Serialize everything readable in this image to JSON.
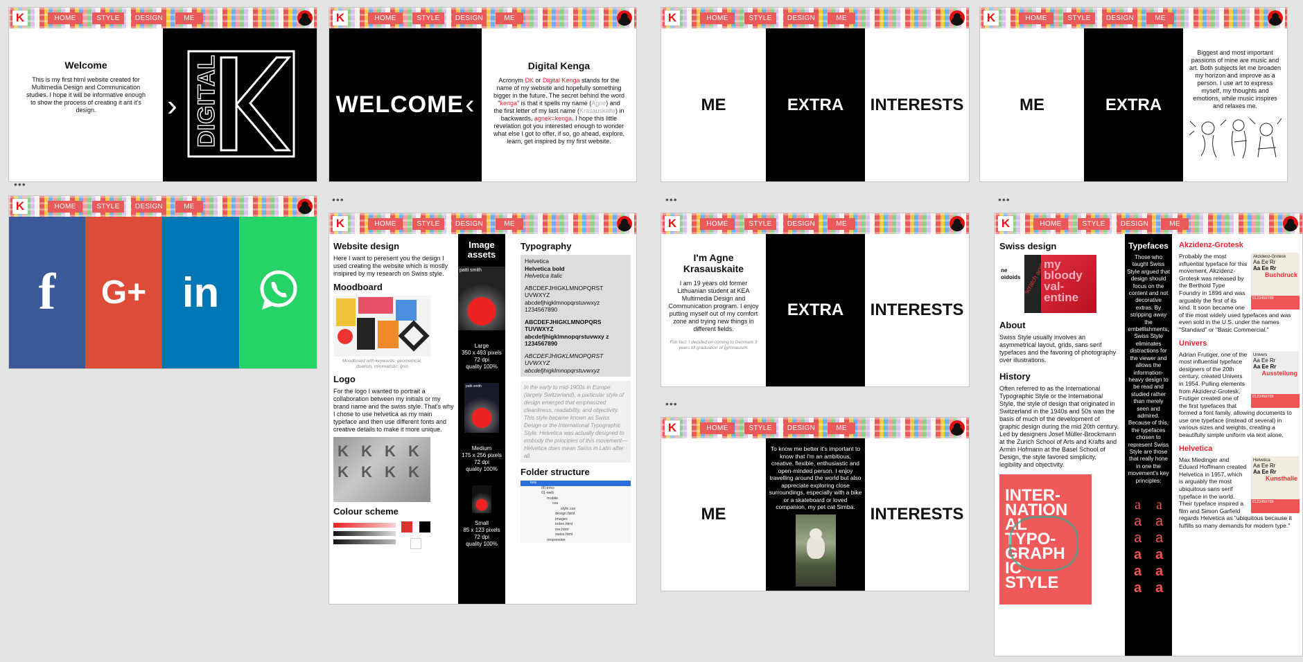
{
  "nav": {
    "logo": "K",
    "home": "HOME",
    "style": "STYLE",
    "design": "DESIGN",
    "me": "ME"
  },
  "dots": "•••",
  "colors": {
    "accent": "#ea5a5a",
    "facebook": "#3b5998",
    "google": "#dd4b39",
    "linkedin": "#0077b5",
    "whatsapp": "#25d366"
  },
  "welcome": {
    "title": "Welcome",
    "text": "This is my first html website created for Multimedia Design and Communication studies. I hope it will be informative enough to show the process of creating it ant it's design.",
    "chevron": "›",
    "logo_word": "DIGITAL",
    "logo_letter": "K"
  },
  "dk": {
    "big": "WELCOME",
    "chevron": "‹",
    "title": "Digital Kenga",
    "p1": "Acronym ",
    "dk": "DK",
    " or": " or ",
    "dkname": "Digital Kenga",
    "p2": " stands for the name of my website and hopefully something bigger in the future. The secret behind the word \"",
    "kenga": "kenga",
    "p3": "\" is that it spells my name (",
    "agne": "Agne",
    "p4": ") and the first letter of my last name (",
    "krasauskaite": "Krasauskaite",
    "p5": ") in backwards, ",
    "agnek": "agnek=kenga",
    "p6": ". I hope this little revelation got you interested enough to wonder what else I got to offer, if so, go ahead, explore, learn, get inspired by my first website."
  },
  "menu": {
    "me": "ME",
    "extra": "EXTRA",
    "interests": "INTERESTS"
  },
  "interests_text": "Biggest and most important passions of mine are music and art. Both subjects let me broaden my horizon and improve as a person. I use art to express myself, my thoughts and emotions, while music inspires and relaxes me.",
  "social": {
    "facebook": "f",
    "google": "G+",
    "linkedin": "in",
    "whatsapp": "whatsapp-icon"
  },
  "about": {
    "title": "I'm Agne Krasauskaite",
    "text": "I am 19 years old former Lithuanian student at KEA Multimedia Design and Communication program. I enjoy putting myself out of my comfort zone and trying new things in different fields.",
    "fun": "Fun fact: I decided on coming to Denmark 3 years till graduation of gymnasium."
  },
  "extra_text": "To know me better it's important to know that I'm an ambitious, creative, flexible, enthusiastic and open-minded person. I enjoy travelling around the world but also appreciate exploring close surroundings, especially with a bike or a skateboard or loved companion, my pet cat Simba.",
  "design": {
    "title": "Website design",
    "intro": "Here I want to peresent you the design I used creating the website which is mostly insipired by my research on Swiss style.",
    "moodboard": "Moodboard",
    "moodcap": "Moodboard with keywords: geometrical, dualism, minimalistic, grid",
    "logo": "Logo",
    "logotext": "For the logo I wanted to portrait a collaboration between my initials or my brand name and the swiss style. That's why I chose to use helvetica as my main typeface and then use different fonts and creative details to make it more unique.",
    "colour": "Colour scheme",
    "assets": "Image assets",
    "assetname": "patti smith",
    "large": [
      "Large",
      "350 x 493 pixels",
      "72 dpi",
      "quality 100%"
    ],
    "medium": [
      "Medium",
      "175 x 256 pixels",
      "72 dpi",
      "quality 100%"
    ],
    "small": [
      "Small",
      "85 x 123 pixels",
      "72 dpi",
      "quality 100%"
    ],
    "typo": "Typography",
    "font": [
      "Helvetica",
      "Helvetica bold",
      "Helvetica italic"
    ],
    "upper": "ABCDEFJHIGKLMNOPQRST UVWXYZ",
    "lower": "abcdefjhigklmnopqrstuvwxyz 1234567890",
    "boldupper": "ABCDEFJHIGKLMNOPQRS TUVWXYZ",
    "boldlower": "abcdefjhigklmnopqrstuvwxy z 1234567890",
    "itupper": "ABCDEFJHIGKLMNOPQRST UVWXYZ",
    "itlower": "abcdefjhigklmnopqrstuvwxyz",
    "quote": "In the early to mid-1900s in Europe (largely Switzerland), a particular style of design emerged that emphasized cleanliness, readability, and objectivity. This style became known as Swiss Design or the International Typographic Style. Helvetica was actually designed to embody the principles of this movement—Helvetica does mean Swiss in Latin after all.",
    "folder": "Folder structure",
    "tree": [
      "kea",
      "00-intro",
      "01-web",
      "mobile",
      "css",
      "style.css",
      "design.html",
      "images",
      "index.html",
      "me.html",
      "swiss.html",
      "responsive"
    ]
  },
  "swiss": {
    "title": "Swiss design",
    "poster_text": [
      "my",
      "bloody",
      "val-",
      "entine"
    ],
    "poster_side": "scratch acid",
    "poster_small": "ne",
    "poster_small2": "oidoids",
    "about": "About",
    "abouttext": "Swiss Style usually involves an asymmetrical layout, grids, sans serif typefaces and the favoring of photography over illustrations.",
    "history": "History",
    "historytext": "Often referred to as the International Typographic Style or the International Style, the style of design that originated in Switzerland in the 1940s and 50s was the basis of much of the development of graphic design during the mid 20th century. Led by designers Josef Müller-Brockmann at the Zurich School of Arts and Krafts and Armin Hofmann at the Basel School of Design, the style favored simplicity, legibility and objectivity.",
    "poster2": [
      "INTER-",
      "NATION",
      "AL",
      "TYPO-",
      "GRAPH",
      "IC",
      "STYLE"
    ],
    "typefaces": "Typefaces",
    "typefacestext": "Those who taught Swiss Style argued that design should focus on the content and not decorative extras. By stripping away the embellishments, Swiss Style eliminates distractions for the viewer and allows the information-heavy design to be read and studied rather than merely seen and admired. Because of this, the typefaces chosen to represent Swiss Style are those that really hone in one the movement's key principles:",
    "glyph": "a",
    "ak": "Akzidenz-Grotesk",
    "aktext": "Probably the most influential typeface for this movement, Akzidenz-Grotesk was released by the Berthold Type Foundry in 1896 and was arguably the first of its kind. It soon became one of the most widely used typefaces and was even sold in the U.S. under the names \"Standard\" or \"Basic Commercial.\"",
    "aksample": "Buchdruck",
    "univers": "Univers",
    "universtext": "Adrian Frutiger, one of the most influential typeface designers of the 20th century, created Univers in 1954. Pulling elements from Akzidenz-Grotesk, Frutiger created one of the first typefaces that formed a font family, allowing documents to use one typeface (instead of several) in various sizes and weights, creating a beautifully simple uniform via text alone.",
    "universsample": "Ausstellung",
    "helv": "Helvetica",
    "helvtext": "Max Miedinger and Eduard Hoffmann created Helvetica in 1957, which is arguably the most ubiquitous sans serif typeface in the world. Their typeface inspired a film and Simon Garfield regards Helvetica as \"ubiquitous because it fulfills so many demands for modern type.\"",
    "helvsample": "Kunsthalle",
    "specimen": "Aa Ee Rr",
    "digits": "0123456789"
  }
}
